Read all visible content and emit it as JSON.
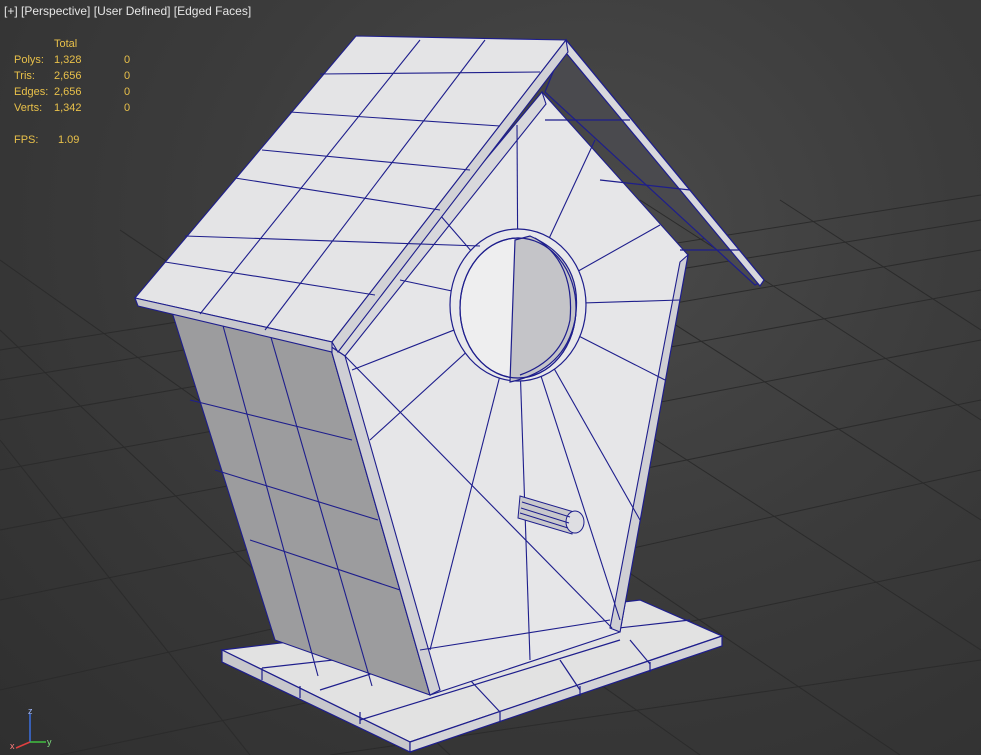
{
  "viewport_label": {
    "plus": "[+]",
    "view": "[Perspective]",
    "shading_mode": "[User Defined]",
    "display": "[Edged Faces]"
  },
  "stats": {
    "header": "Total",
    "rows": [
      {
        "label": "Polys:",
        "total": "1,328",
        "selected": "0"
      },
      {
        "label": "Tris:",
        "total": "2,656",
        "selected": "0"
      },
      {
        "label": "Edges:",
        "total": "2,656",
        "selected": "0"
      },
      {
        "label": "Verts:",
        "total": "1,342",
        "selected": "0"
      }
    ],
    "fps_label": "FPS:",
    "fps_value": "1.09"
  },
  "axis": {
    "z": "z",
    "x": "x",
    "y": "y"
  },
  "colors": {
    "stats_text": "#e8c04a",
    "wire": "#1e1e8c",
    "surface": "#dcdcdc",
    "grid": "#2a2a2a"
  }
}
